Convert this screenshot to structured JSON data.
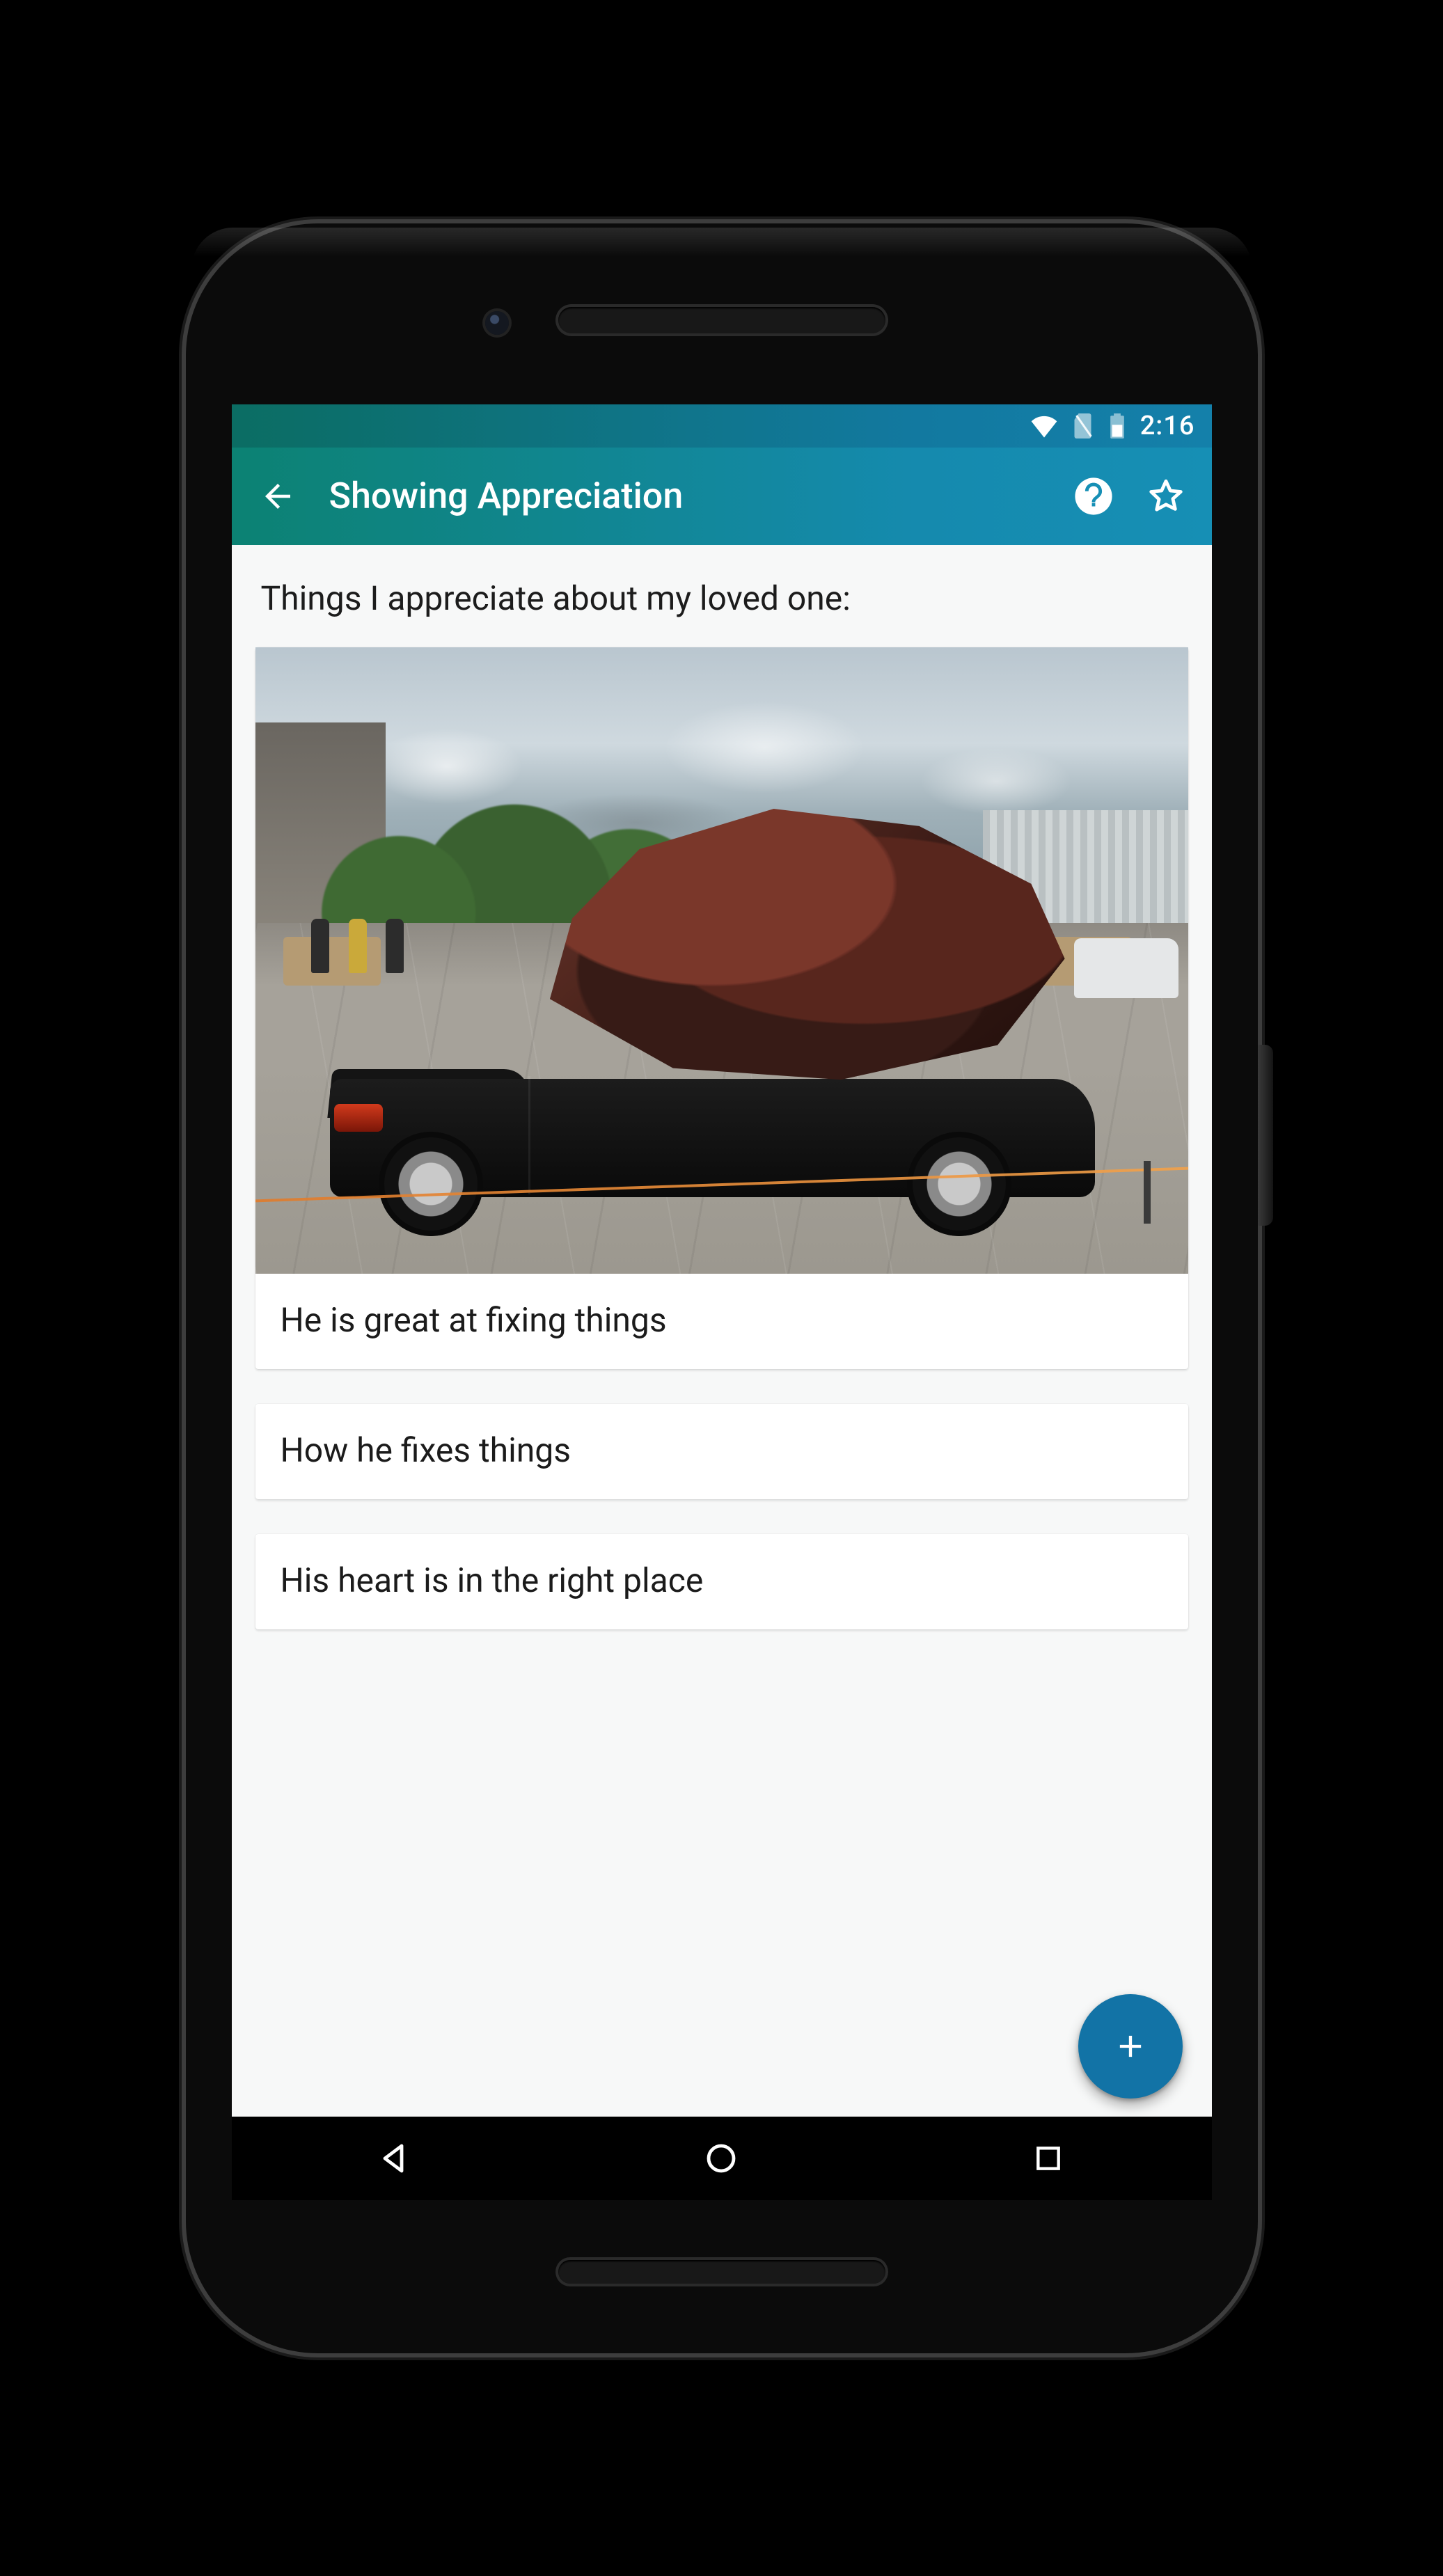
{
  "status": {
    "time": "2:16"
  },
  "appbar": {
    "title": "Showing Appreciation"
  },
  "content": {
    "prompt": "Things I appreciate about my loved one:",
    "cards": [
      {
        "text": "He is great at fixing things",
        "hasImage": true
      },
      {
        "text": "How he fixes things",
        "hasImage": false
      },
      {
        "text": "His heart is in the right place",
        "hasImage": false
      }
    ]
  },
  "icons": {
    "back": "back-arrow-icon",
    "help": "help-circle-icon",
    "star": "star-outline-icon",
    "add": "plus-icon",
    "navBack": "nav-back-icon",
    "navHome": "nav-home-icon",
    "navRecent": "nav-recent-icon",
    "wifi": "wifi-icon",
    "sim": "no-sim-icon",
    "battery": "battery-icon"
  }
}
